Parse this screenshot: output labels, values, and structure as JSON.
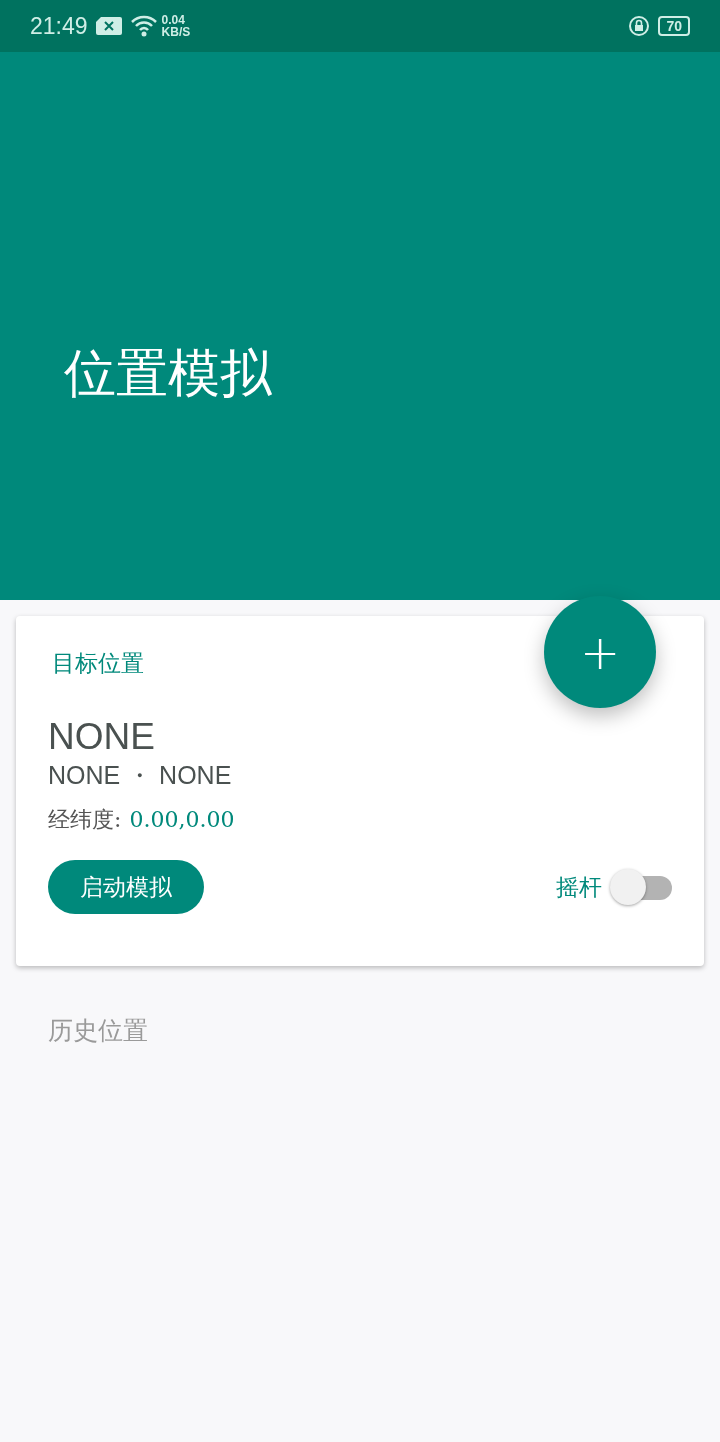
{
  "status_bar": {
    "time": "21:49",
    "net_speed": "0.04",
    "net_unit": "KB/S",
    "battery": "70"
  },
  "header": {
    "title": "位置模拟"
  },
  "fab": {
    "label": "+"
  },
  "target_card": {
    "section_title": "目标位置",
    "name": "NONE",
    "subtitle": "NONE ・ NONE",
    "coords_label": "经纬度:",
    "coords_value": "0.00,0.00",
    "start_button": "启动模拟",
    "joystick_label": "摇杆",
    "joystick_on": false
  },
  "history": {
    "title": "历史位置"
  }
}
